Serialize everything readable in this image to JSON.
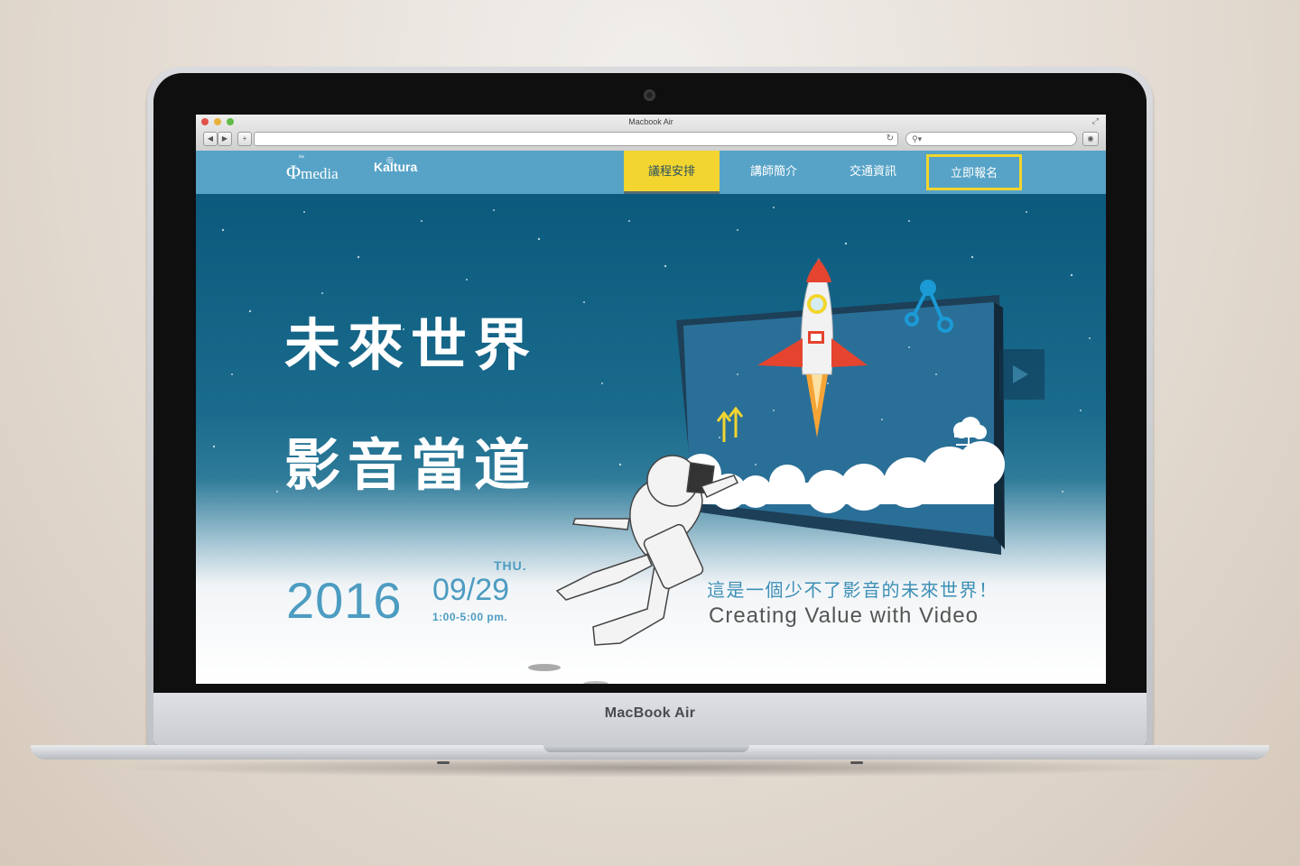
{
  "device": {
    "brand_label": "MacBook Air"
  },
  "browser": {
    "window_title": "Macbook Air",
    "back_label": "◀",
    "forward_label": "▶",
    "new_tab_label": "+",
    "reload_icon": "↻",
    "search_icon": "🔍",
    "url": "",
    "search_placeholder": ""
  },
  "site": {
    "logos": {
      "media": "media",
      "media_prefix": "the",
      "media_tagline": "",
      "kaltura": "Kaltura",
      "kaltura_tagline": ""
    },
    "nav": [
      {
        "label": "議程安排",
        "state": "active"
      },
      {
        "label": "講師簡介",
        "state": "normal"
      },
      {
        "label": "交通資訊",
        "state": "normal"
      },
      {
        "label": "立即報名",
        "state": "cta"
      }
    ]
  },
  "hero": {
    "headline_line1": "未來世界",
    "headline_line2": "影音當道",
    "year": "2016",
    "date": "09/29",
    "weekday": "THU.",
    "time": "1:00-5:00 pm.",
    "tagline_zh": "這是一個少不了影音的未來世界！",
    "tagline_en": "Creating Value with Video"
  },
  "colors": {
    "nav_bg": "#57a3c7",
    "nav_active": "#f2d52f",
    "hero_top": "#0b5a7d",
    "accent_blue": "#4d9cc1",
    "rocket_red": "#e5442f",
    "flame_orange": "#f7a436"
  },
  "icons": [
    "back-icon",
    "forward-icon",
    "reload-icon",
    "search-icon",
    "download-icon",
    "rocket-icon",
    "share-icon",
    "video-icon",
    "cloud-icon",
    "astronaut-icon"
  ]
}
